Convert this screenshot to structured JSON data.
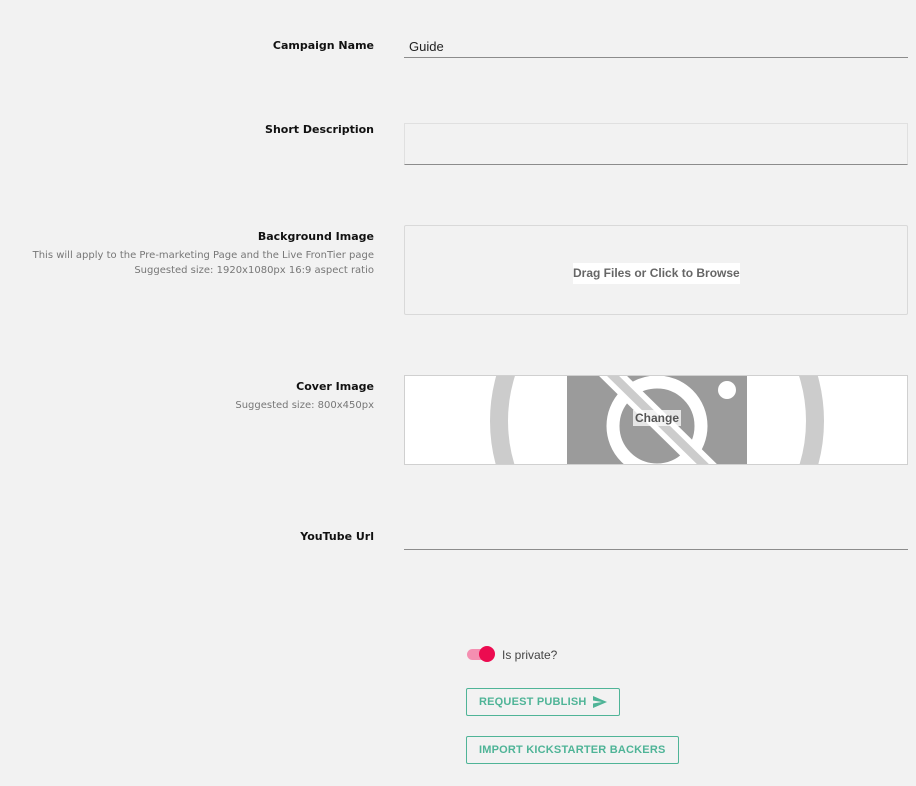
{
  "form": {
    "campaign_name": {
      "label": "Campaign Name",
      "value": "Guide"
    },
    "short_description": {
      "label": "Short Description",
      "value": ""
    },
    "background_image": {
      "label": "Background Image",
      "hints": [
        "This will apply to the Pre-marketing Page and the Live FronTier page",
        "Suggested size: 1920x1080px 16:9 aspect ratio"
      ],
      "dropzone_text": "Drag Files or Click to Browse"
    },
    "cover_image": {
      "label": "Cover Image",
      "hint": "Suggested size: 800x450px",
      "change_label": "Change",
      "placeholder_icon": "broken-image-icon"
    },
    "youtube_url": {
      "label": "YouTube Url",
      "value": ""
    }
  },
  "private_toggle": {
    "label": "Is private?",
    "checked": true,
    "color": "#ec0b50"
  },
  "actions": {
    "request_publish": {
      "label": "REQUEST PUBLISH",
      "icon": "send-icon"
    },
    "import_backers": {
      "label": "IMPORT KICKSTARTER BACKERS"
    },
    "accent_color": "#4fb497"
  }
}
